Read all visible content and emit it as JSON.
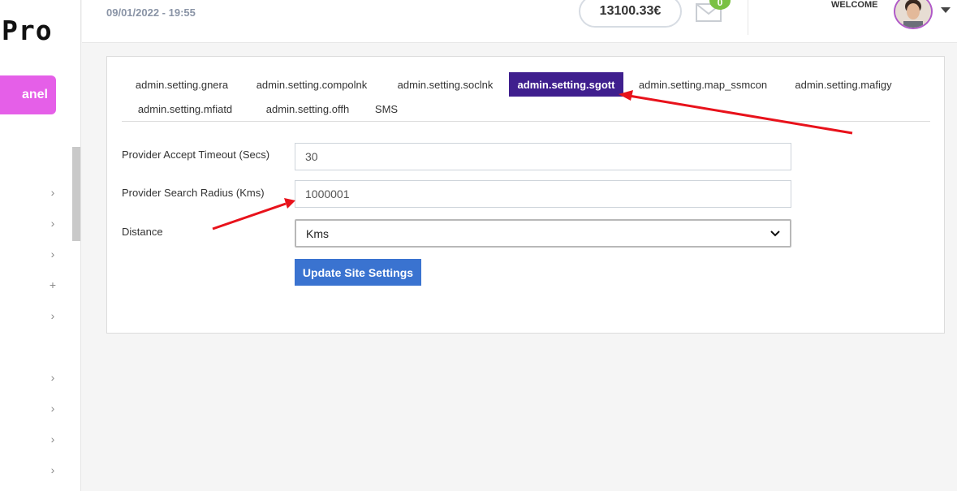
{
  "brand": {
    "name": "Pro"
  },
  "sidebar": {
    "panel_label": "anel"
  },
  "header": {
    "datetime": "09/01/2022 - 19:55",
    "balance": "13100.33€",
    "mail_count": "0",
    "welcome": "WELCOME"
  },
  "tabs": [
    {
      "label": "admin.setting.gnera",
      "active": false
    },
    {
      "label": "admin.setting.compolnk",
      "active": false
    },
    {
      "label": "admin.setting.soclnk",
      "active": false
    },
    {
      "label": "admin.setting.sgott",
      "active": true
    },
    {
      "label": "admin.setting.map_ssmcon",
      "active": false
    },
    {
      "label": "admin.setting.mafigy",
      "active": false
    },
    {
      "label": "admin.setting.mfiatd",
      "active": false
    },
    {
      "label": "admin.setting.offh",
      "active": false
    },
    {
      "label": "SMS",
      "active": false
    }
  ],
  "form": {
    "accept_timeout": {
      "label": "Provider Accept Timeout (Secs)",
      "value": "30"
    },
    "search_radius": {
      "label": "Provider Search Radius (Kms)",
      "value": "1000001"
    },
    "distance": {
      "label": "Distance",
      "selected": "Kms"
    },
    "submit_label": "Update Site Settings"
  },
  "colors": {
    "accent": "#3f1f8e",
    "panel": "#e55fe8",
    "button": "#3a73d0",
    "badge": "#7ac143",
    "annotation": "#e8121b"
  }
}
